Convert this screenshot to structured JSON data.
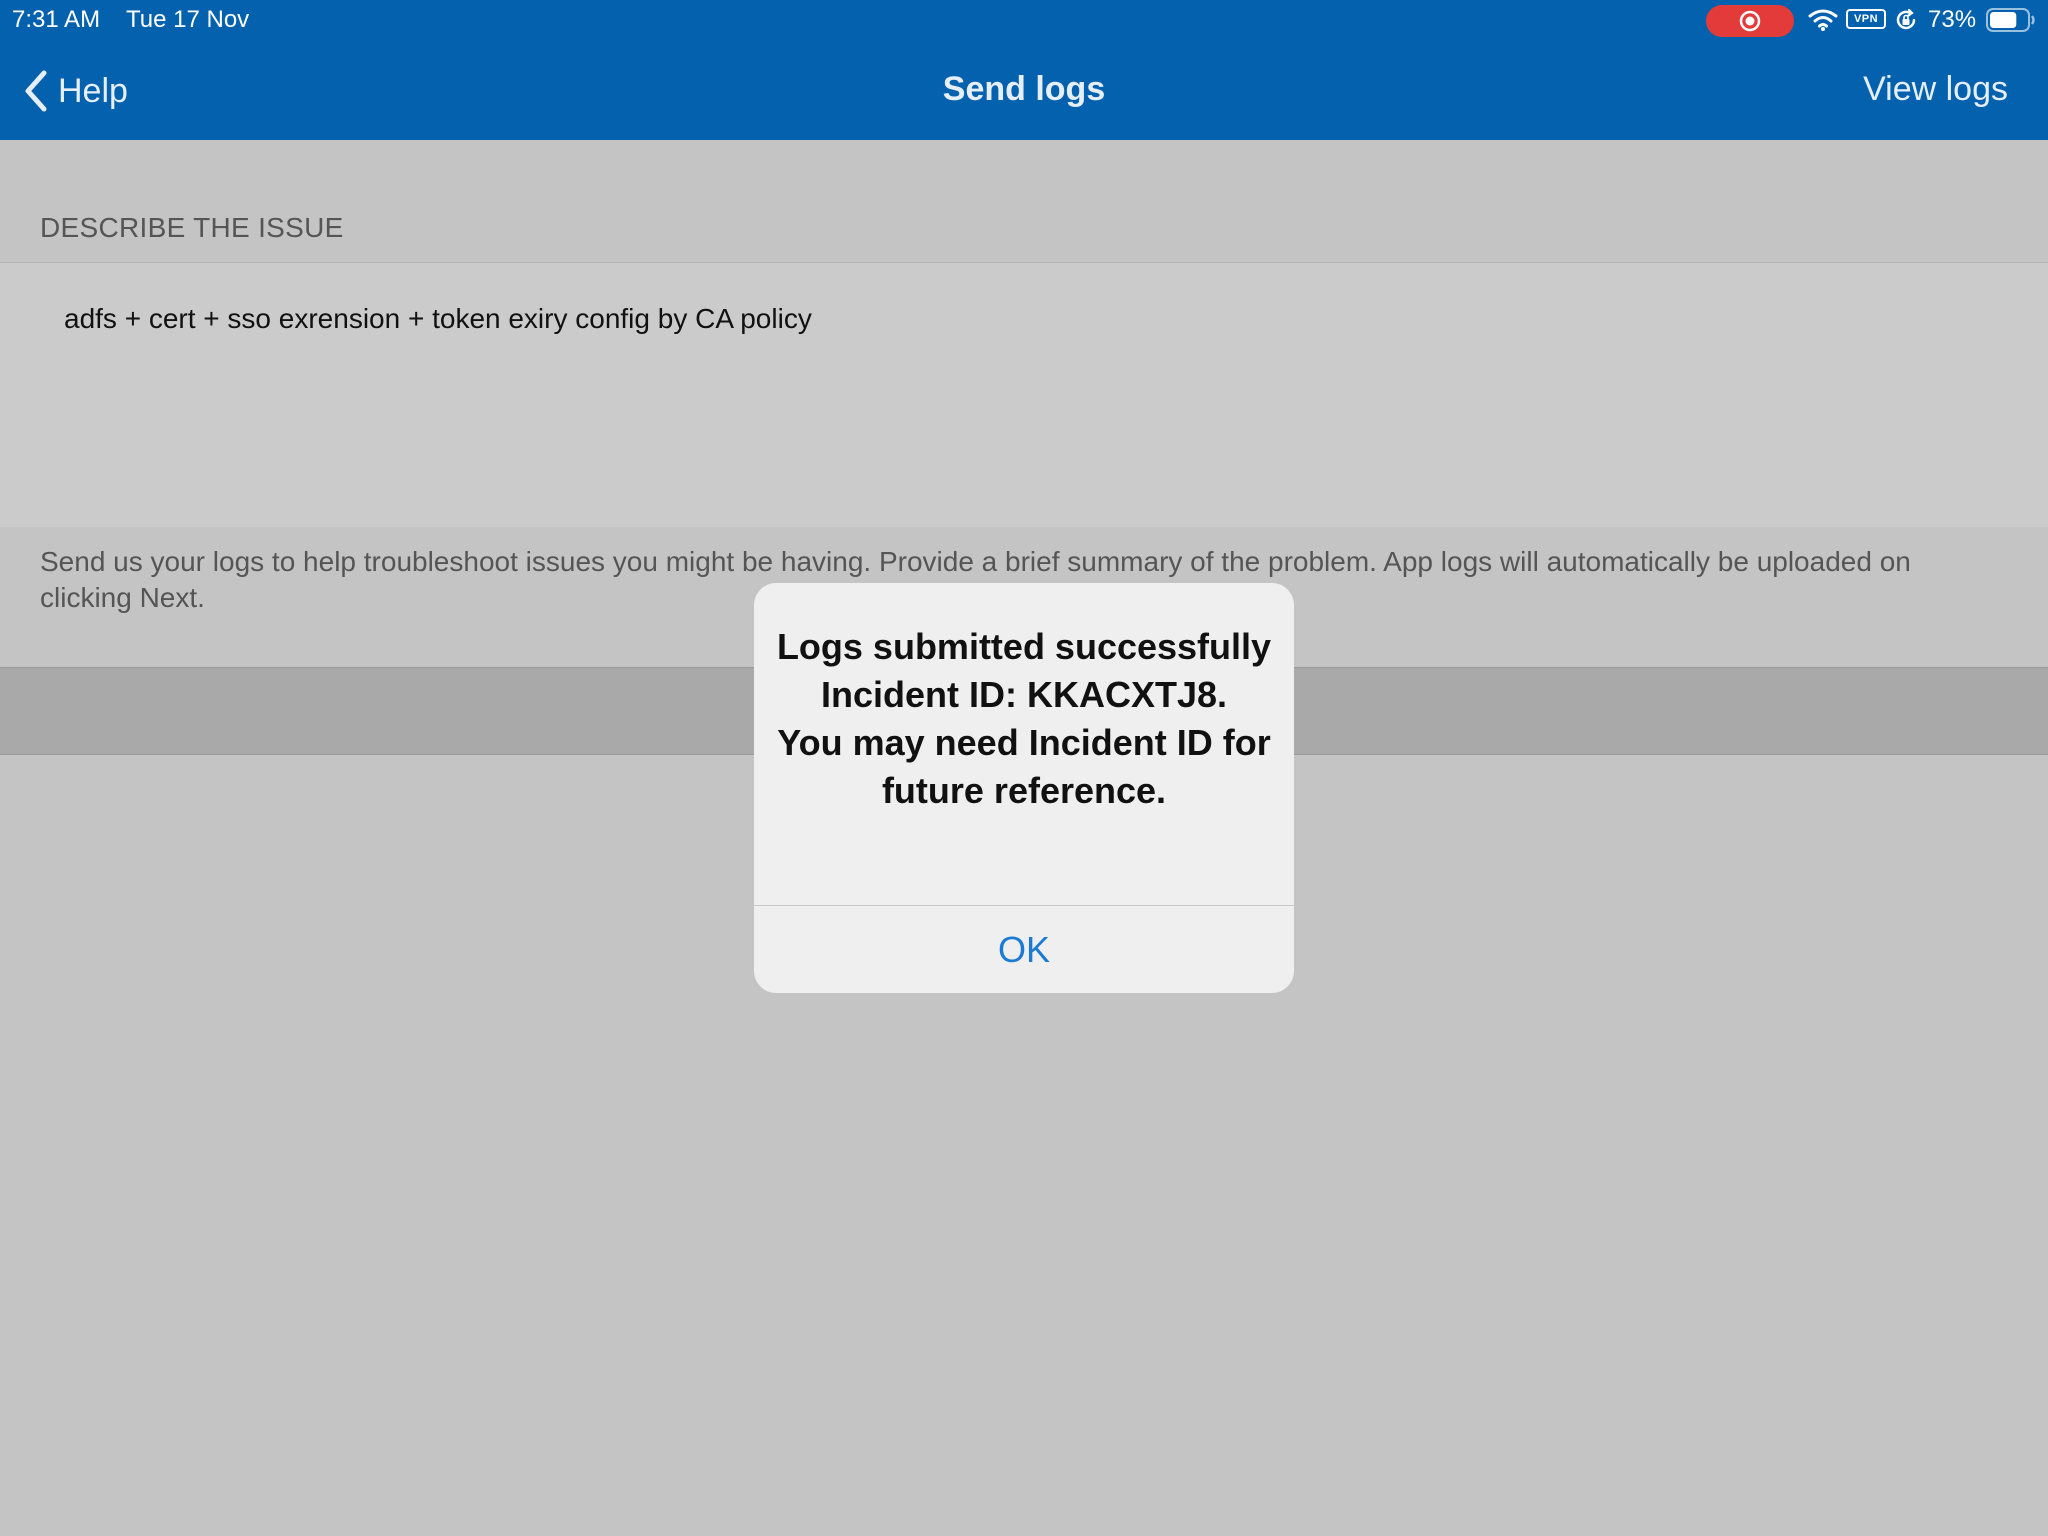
{
  "status_bar": {
    "time": "7:31 AM",
    "date": "Tue 17 Nov",
    "vpn_label": "VPN",
    "battery_percent": "73%",
    "battery_level": 0.73,
    "record_color": "#e33b3a",
    "icons": [
      "record-icon",
      "wifi-icon",
      "lock-rotation-icon",
      "battery-icon"
    ]
  },
  "nav": {
    "back_label": "Help",
    "title": "Send logs",
    "right_action": "View logs",
    "bar_color": "#0361ae"
  },
  "form": {
    "section_header": "DESCRIBE THE ISSUE",
    "issue_text": "adfs + cert + sso exrension + token exiry config by CA policy",
    "help_text": "Send us your logs to help troubleshoot issues you might be having. Provide a brief summary of the problem. App logs will automatically be uploaded on clicking Next."
  },
  "alert": {
    "message": "Logs submitted successfully\nIncident ID: KKACXTJ8.\nYou may need Incident ID for future reference.",
    "ok_label": "OK",
    "ok_color": "#1a7ad4"
  }
}
